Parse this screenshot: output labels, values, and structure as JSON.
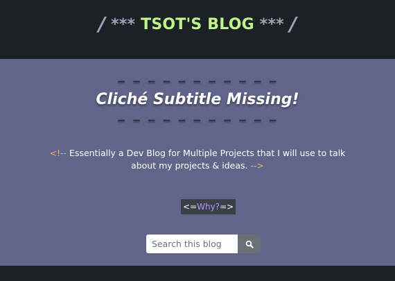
{
  "header": {
    "slash_left": "/",
    "stars_left": "***",
    "blog_name": "TSOT'S BLOG",
    "stars_right": "***",
    "slash_right": "/"
  },
  "hero": {
    "dashes_top": "– – – – – – – – – – –",
    "subtitle": "Cliché Subtitle Missing!",
    "dashes_bottom": "– – – – – – – – – – –",
    "comment_open": "<!--",
    "description": "Essentially a Dev Blog for Multiple Projects that I will use to talk about my projects & ideas.",
    "comment_close": "-->"
  },
  "why_button": {
    "prefix": "<=",
    "label": "Why?",
    "suffix": "=>"
  },
  "search": {
    "placeholder": "Search this blog",
    "icon": "search-icon"
  },
  "colors": {
    "header_bg": "#1b2124",
    "hero_bg": "#616589",
    "accent_green": "#bdf58a",
    "accent_purple": "#b893ff",
    "comment_orange": "#f0b36e"
  }
}
